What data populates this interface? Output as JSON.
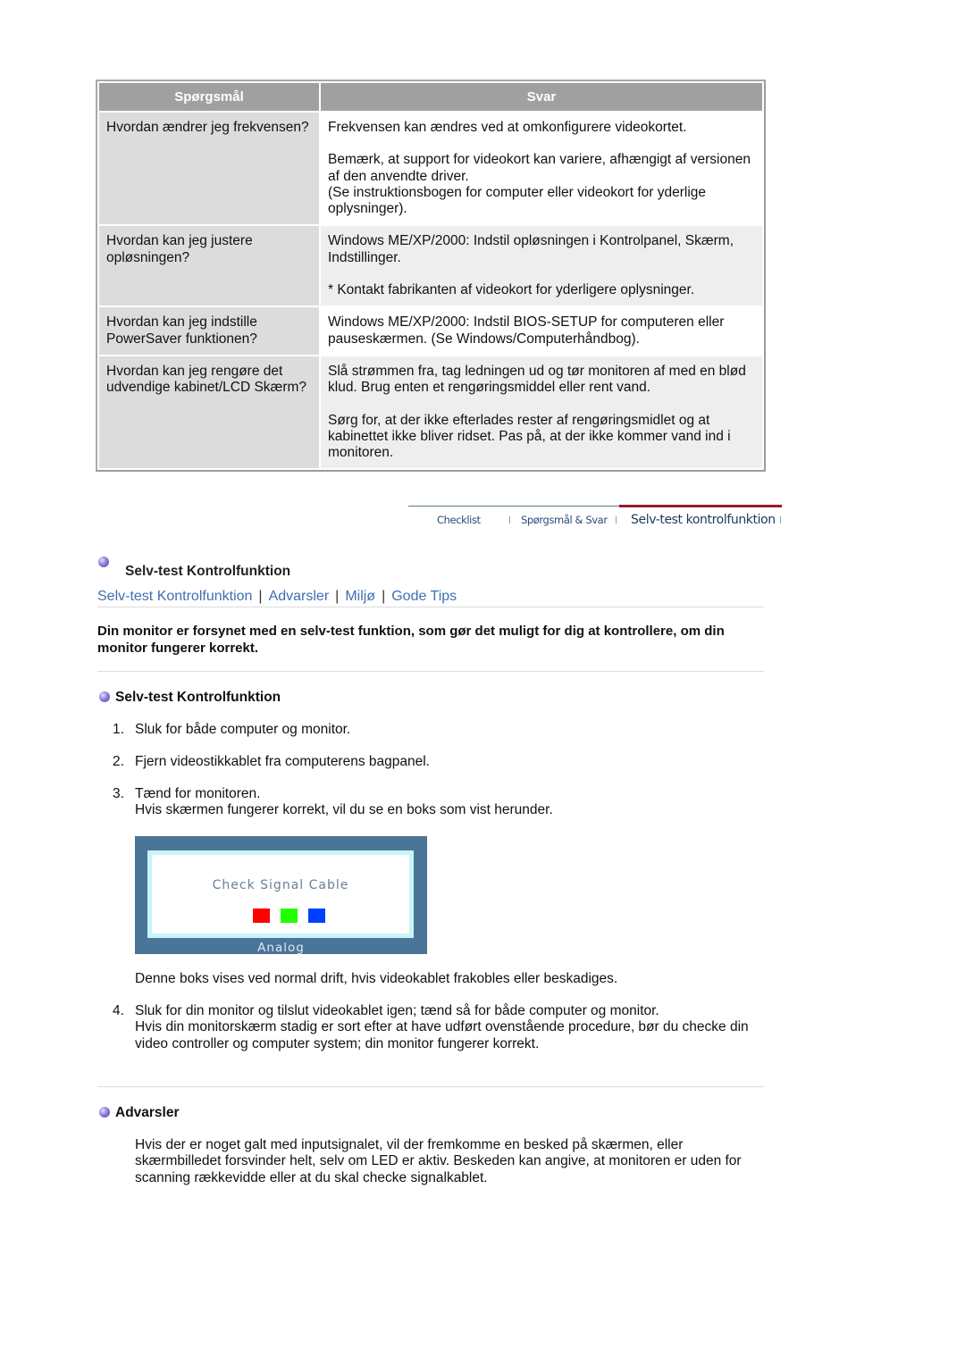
{
  "faq": {
    "headers": {
      "question": "Spørgsmål",
      "answer": "Svar"
    },
    "rows": [
      {
        "question": "Hvordan ændrer jeg frekvensen?",
        "answer": [
          "Frekvensen kan ændres ved at omkonfigurere videokortet.",
          "Bemærk, at support for videokort kan variere, afhængigt af versionen af den anvendte driver.",
          "(Se instruktionsbogen for computer eller videokort for yderlige oplysninger)."
        ]
      },
      {
        "question": "Hvordan kan jeg justere opløsningen?",
        "answer": [
          "Windows ME/XP/2000: Indstil opløsningen i Kontrolpanel, Skærm, Indstillinger.",
          "* Kontakt fabrikanten af videokort for yderligere oplysninger."
        ]
      },
      {
        "question": "Hvordan kan jeg indstille PowerSaver funktionen?",
        "answer": [
          "Windows ME/XP/2000: Indstil BIOS-SETUP for computeren eller pauseskærmen. (Se Windows/Computerhåndbog)."
        ]
      },
      {
        "question": "Hvordan kan jeg rengøre det udvendige kabinet/LCD Skærm?",
        "answer": [
          "Slå strømmen fra, tag ledningen ud og tør monitoren af med en blød klud. Brug enten et rengøringsmiddel eller rent vand.",
          "Sørg for, at der ikke efterlades rester af rengøringsmidlet og at kabinettet ikke bliver ridset. Pas på, at der ikke kommer vand ind i monitoren."
        ]
      }
    ]
  },
  "subnav": {
    "items": [
      "Checklist",
      "Spørgsmål & Svar",
      "Selv-test kontrolfunktion"
    ],
    "active_index": 2,
    "active_color": "#9b1a2c"
  },
  "section": {
    "title": "Selv-test Kontrolfunktion",
    "links": [
      "Selv-test Kontrolfunktion",
      "Advarsler",
      "Miljø",
      "Gode Tips"
    ],
    "link_color": "#3d6fb0",
    "intro": "Din monitor er forsynet med en selv-test funktion, som gør det muligt for dig at kontrollere, om din monitor fungerer korrekt."
  },
  "selftest": {
    "heading": "Selv-test Kontrolfunktion",
    "steps": [
      {
        "num": "1.",
        "lines": [
          "Sluk for både computer og monitor."
        ]
      },
      {
        "num": "2.",
        "lines": [
          "Fjern videostikkablet fra computerens bagpanel."
        ]
      },
      {
        "num": "3.",
        "lines": [
          "Tænd for monitoren.",
          "Hvis skærmen fungerer korrekt, vil du se en boks som vist herunder."
        ]
      },
      {
        "num": "4.",
        "lines": [
          "Sluk for din monitor og tilslut videokablet igen; tænd så for både computer og monitor.",
          "Hvis din monitorskærm stadig er sort efter at have udført ovenstående procedure, bør du checke din video controller og computer system; din monitor fungerer korrekt."
        ]
      }
    ],
    "osd": {
      "title": "Check Signal Cable",
      "mode": "Analog",
      "colors": [
        "#ff0000",
        "#22ff00",
        "#0040ff"
      ]
    },
    "osd_note": "Denne boks vises ved normal drift, hvis videokablet frakobles eller beskadiges."
  },
  "warnings": {
    "heading": "Advarsler",
    "text": "Hvis der er noget galt med inputsignalet, vil der fremkomme en besked på skærmen, eller skærmbilledet forsvinder helt, selv om LED er aktiv. Beskeden kan angive, at monitoren er uden for scanning rækkevidde eller at du skal checke signalkablet."
  }
}
